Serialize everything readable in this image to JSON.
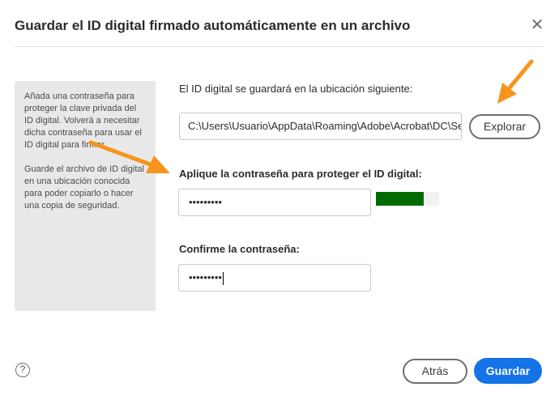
{
  "dialog": {
    "title": "Guardar el ID digital firmado automáticamente en un archivo",
    "close_glyph": "✕"
  },
  "info": {
    "paragraph1": "Añada una contraseña para proteger la clave privada del ID digital. Volverá a necesitar dicha contraseña para usar el ID digital para firmar.",
    "paragraph2": "Guarde el archivo de ID digital en una ubicación conocida para poder copiarlo o hacer una copia de seguridad."
  },
  "location": {
    "label": "El ID digital se guardará en la ubicación siguiente:",
    "path": "C:\\Users\\Usuario\\AppData\\Roaming\\Adobe\\Acrobat\\DC\\Security",
    "browse_label": "Explorar"
  },
  "password": {
    "label": "Aplique la contraseña para proteger el ID digital:",
    "value": "•••••••••",
    "strength": 0.76,
    "strength_color": "#006b00"
  },
  "confirm": {
    "label": "Confirme la contraseña:",
    "value": "•••••••••"
  },
  "footer": {
    "help_glyph": "?",
    "back_label": "Atrás",
    "save_label": "Guardar"
  },
  "colors": {
    "accent": "#1473e6",
    "annotation_arrow": "#f7941d"
  },
  "icons": {
    "close": "close-icon",
    "help": "help-icon",
    "annotation": "arrow-annotation-icon"
  }
}
